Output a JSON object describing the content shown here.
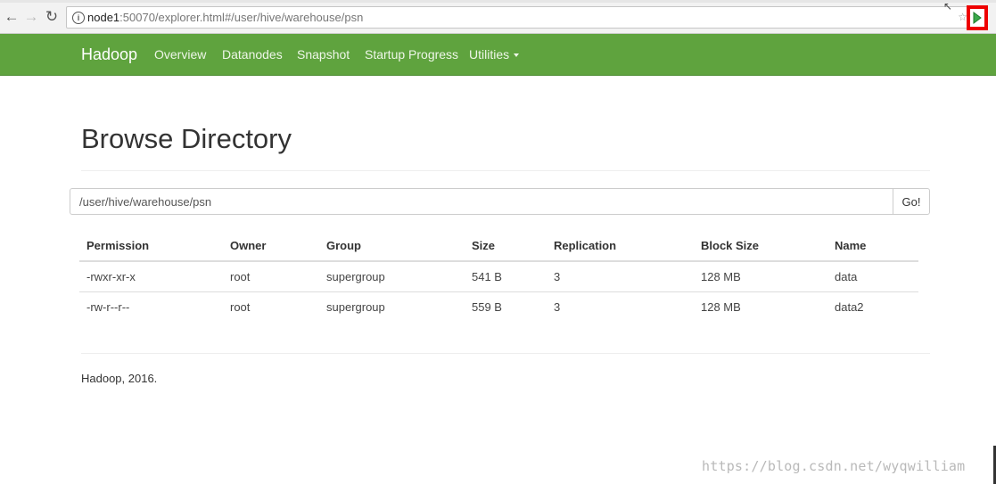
{
  "browser": {
    "url_host": "node1",
    "url_rest": ":50070/explorer.html#/user/hive/warehouse/psn"
  },
  "navbar": {
    "brand": "Hadoop",
    "items": [
      "Overview",
      "Datanodes",
      "Snapshot",
      "Startup Progress",
      "Utilities"
    ]
  },
  "page": {
    "title": "Browse Directory",
    "path_value": "/user/hive/warehouse/psn",
    "go_label": "Go!"
  },
  "table": {
    "headers": [
      "Permission",
      "Owner",
      "Group",
      "Size",
      "Replication",
      "Block Size",
      "Name"
    ],
    "rows": [
      [
        "-rwxr-xr-x",
        "root",
        "supergroup",
        "541 B",
        "3",
        "128 MB",
        "data"
      ],
      [
        "-rw-r--r--",
        "root",
        "supergroup",
        "559 B",
        "3",
        "128 MB",
        "data2"
      ]
    ]
  },
  "footer": {
    "text": "Hadoop, 2016."
  },
  "watermark": "https://blog.csdn.net/wyqwilliam",
  "colors": {
    "navbar": "#5fa33e",
    "link": "#337ab7"
  },
  "icons": [
    "back-arrow-icon",
    "forward-arrow-icon",
    "reload-icon",
    "info-icon",
    "star-icon",
    "extension-play-icon",
    "mouse-cursor-icon"
  ]
}
